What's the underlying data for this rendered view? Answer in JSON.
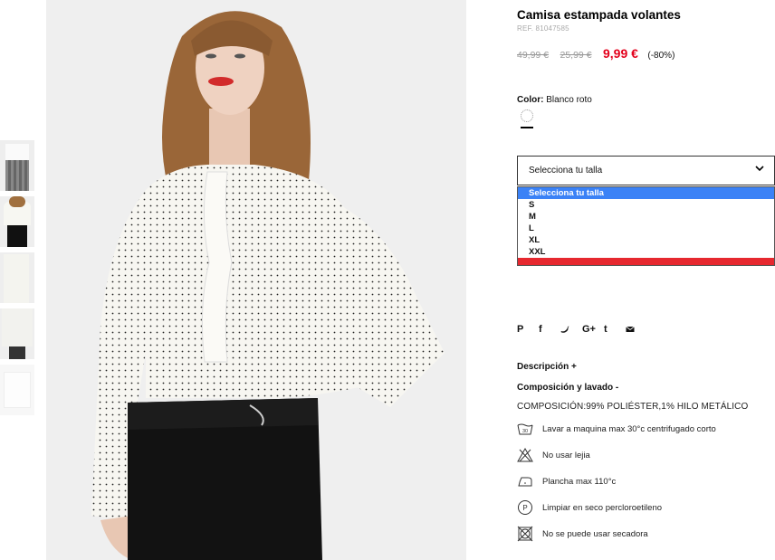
{
  "product": {
    "title": "Camisa estampada volantes",
    "ref": "REF. 81047585",
    "price_original": "49,99 €",
    "price_previous": "25,99 €",
    "price_current": "9,99 €",
    "discount": "(-80%)"
  },
  "color": {
    "label": "Color:",
    "value": "Blanco roto"
  },
  "size": {
    "select_label": "Selecciona tu talla",
    "options": [
      "Selecciona tu talla",
      "S",
      "M",
      "L",
      "XL",
      "XXL"
    ],
    "selected_index": 0
  },
  "social": {
    "icons": [
      "pinterest-icon",
      "facebook-icon",
      "twitter-icon",
      "google-plus-icon",
      "tumblr-icon",
      "email-icon"
    ],
    "labels": [
      "P",
      "f",
      "",
      "G+",
      "t",
      ""
    ]
  },
  "sections": {
    "description": "Descripción +",
    "composition": "Composición y lavado -",
    "composition_text": "COMPOSICIÓN:99% POLIÉSTER,1% HILO METÁLICO"
  },
  "care": [
    {
      "icon": "wash-30-icon",
      "text": "Lavar a maquina max 30°c centrifugado corto",
      "badge": "30"
    },
    {
      "icon": "no-bleach-icon",
      "text": "No usar lejia"
    },
    {
      "icon": "iron-icon",
      "text": "Plancha max 110°c"
    },
    {
      "icon": "dry-clean-p-icon",
      "text": "Limpiar en seco percloroetileno",
      "badge": "P"
    },
    {
      "icon": "no-tumble-dry-icon",
      "text": "No se puede usar secadora"
    }
  ],
  "colors": {
    "price_red": "#e3001b",
    "select_highlight": "#3b82f6",
    "bar_red": "#e6282f"
  }
}
